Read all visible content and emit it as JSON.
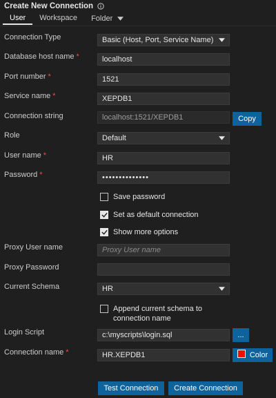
{
  "title": "Create New Connection",
  "tabs": [
    {
      "label": "User"
    },
    {
      "label": "Workspace"
    },
    {
      "label": "Folder"
    }
  ],
  "form": {
    "connection_type": {
      "label": "Connection Type",
      "value": "Basic (Host, Port, Service Name)"
    },
    "host": {
      "label": "Database host name",
      "value": "localhost"
    },
    "port": {
      "label": "Port number",
      "value": "1521"
    },
    "service": {
      "label": "Service name",
      "value": "XEPDB1"
    },
    "conn_string": {
      "label": "Connection string",
      "value": "localhost:1521/XEPDB1",
      "button": "Copy"
    },
    "role": {
      "label": "Role",
      "value": "Default"
    },
    "username": {
      "label": "User name",
      "value": "HR"
    },
    "password": {
      "label": "Password",
      "value": "••••••••••••••"
    },
    "save_password": {
      "label": "Save password",
      "checked": false
    },
    "default_conn": {
      "label": "Set as default connection",
      "checked": true
    },
    "more_options": {
      "label": "Show more options",
      "checked": true
    },
    "proxy_user": {
      "label": "Proxy User name",
      "value": "",
      "placeholder": "Proxy User name"
    },
    "proxy_password": {
      "label": "Proxy Password",
      "value": ""
    },
    "current_schema": {
      "label": "Current Schema",
      "value": "HR"
    },
    "append_schema": {
      "label": "Append current schema to connection name",
      "checked": false
    },
    "login_script": {
      "label": "Login Script",
      "value": "c:\\myscripts\\login.sql",
      "button": "..."
    },
    "connection_name": {
      "label": "Connection name",
      "value": "HR.XEPDB1",
      "color_button": "Color",
      "color": "#e51400"
    }
  },
  "actions": {
    "test": "Test Connection",
    "create": "Create Connection"
  },
  "required_marker": "*"
}
